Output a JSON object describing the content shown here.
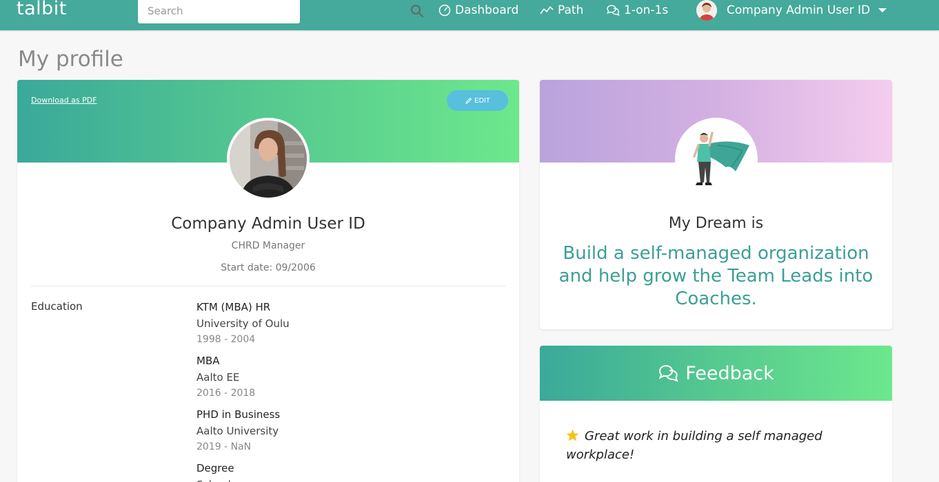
{
  "nav": {
    "logo": "talbit",
    "search_placeholder": "Search",
    "dashboard": "Dashboard",
    "path": "Path",
    "one_on_ones": "1-on-1s",
    "user_name": "Company Admin User ID"
  },
  "page": {
    "title": "My profile"
  },
  "profile": {
    "download_pdf": "Download as PDF",
    "edit_label": "EDIT",
    "name": "Company Admin User ID",
    "role": "CHRD Manager",
    "start_date": "Start date: 09/2006",
    "education_label": "Education",
    "education": [
      {
        "degree": "KTM (MBA) HR",
        "school": "University of Oulu",
        "years": "1998 - 2004"
      },
      {
        "degree": "MBA",
        "school": "Aalto EE",
        "years": "2016 - 2018"
      },
      {
        "degree": "PHD in Business",
        "school": "Aalto University",
        "years": "2019 - NaN"
      },
      {
        "degree": "Degree",
        "school": "School",
        "years": ""
      }
    ]
  },
  "dream": {
    "heading": "My Dream is",
    "text": "Build a self-managed organization and help grow the Team Leads into Coaches."
  },
  "feedback": {
    "title": "Feedback",
    "items": [
      {
        "text": "Great work in building a self managed workplace!"
      }
    ]
  },
  "colors": {
    "nav_bg": "#45a99b",
    "accent_text": "#3c9f96",
    "edit_button": "#58bfdc",
    "star": "#f2c418"
  }
}
